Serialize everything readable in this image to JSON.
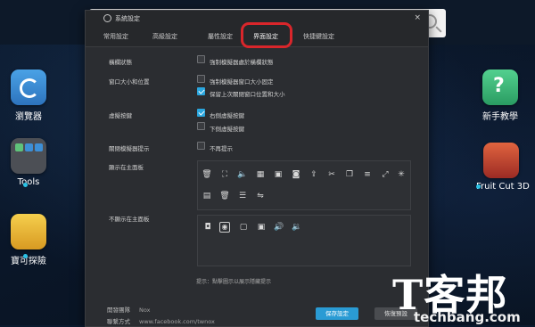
{
  "dialog": {
    "title": "系統設定",
    "close_glyph": "×",
    "tabs": [
      {
        "label": "常用設定"
      },
      {
        "label": "高級設定"
      },
      {
        "label": "屬性設定"
      },
      {
        "label": "界面設定",
        "active": true
      },
      {
        "label": "快捷鍵設定"
      }
    ],
    "highlight_color": "#d9262b"
  },
  "settings": {
    "sidebar_state": {
      "label": "橫欄狀態",
      "option": "強制模擬器處於橫欄狀態",
      "checked": false
    },
    "window_size": {
      "label": "窗口大小和位置",
      "options": [
        {
          "text": "強制模擬器窗口大小固定",
          "checked": false
        },
        {
          "text": "保留上次關閉窗口位置和大小",
          "checked": true
        }
      ]
    },
    "virtual_keys": {
      "label": "虛擬按鍵",
      "options": [
        {
          "text": "右側虛擬按鍵",
          "checked": true
        },
        {
          "text": "下側虛擬按鍵",
          "checked": false
        }
      ]
    },
    "close_prompt": {
      "label": "關閉模擬器提示",
      "option": "不再提示",
      "checked": false
    },
    "show_panel": {
      "label": "顯示在主面板",
      "row1": [
        {
          "icon": "trash-icon",
          "glyph": "🗑"
        },
        {
          "icon": "expand-icon",
          "glyph": "⛶"
        },
        {
          "icon": "volume-up-icon",
          "glyph": "🔈"
        },
        {
          "icon": "package-icon",
          "glyph": "▦"
        },
        {
          "icon": "screenshot-icon",
          "glyph": "▣"
        },
        {
          "icon": "camera-icon",
          "glyph": "◙"
        },
        {
          "icon": "share-icon",
          "glyph": "⇪"
        },
        {
          "icon": "scissors-icon",
          "glyph": "✂"
        },
        {
          "icon": "copy-icon",
          "glyph": "❐"
        },
        {
          "icon": "menu-icon",
          "glyph": "≡"
        },
        {
          "icon": "arrows-icon",
          "glyph": "⤢"
        },
        {
          "icon": "loading-icon",
          "glyph": "✳"
        }
      ],
      "row2": [
        {
          "icon": "stack-icon",
          "glyph": "▤"
        },
        {
          "icon": "delete-icon",
          "glyph": "🗑"
        },
        {
          "icon": "list-icon",
          "glyph": "☰"
        },
        {
          "icon": "sliders-icon",
          "glyph": "⇋"
        }
      ]
    },
    "hidden_panel": {
      "label": "不顯示在主面板",
      "items": [
        {
          "icon": "camera-icon",
          "glyph": "◘"
        },
        {
          "icon": "location-icon",
          "glyph": "◉",
          "selected": true
        },
        {
          "icon": "screen-record-icon",
          "glyph": "▢"
        },
        {
          "icon": "image-icon",
          "glyph": "▣"
        },
        {
          "icon": "volume-up-icon",
          "glyph": "🔊"
        },
        {
          "icon": "volume-down-icon",
          "glyph": "🔉"
        }
      ]
    },
    "hint": "提示：點擊圖示以展示隱藏提示"
  },
  "footer": {
    "developer_label": "開發團隊",
    "developer_value": "Nox",
    "contact_label": "聯繫方式",
    "contact_value": "www.facebook.com/twnox",
    "save_label": "保存設定",
    "reset_label": "恢復預設"
  },
  "desktop": {
    "left_apps": [
      {
        "label": "瀏覽器",
        "color": "#3a8fd8"
      },
      {
        "label": "Tools",
        "color": "#4c4f55"
      },
      {
        "label": "寶可探險",
        "color": "#e8b33a"
      }
    ],
    "right_apps": [
      {
        "label": "新手教學",
        "color": "#39b97a"
      },
      {
        "label": "Fruit Cut 3D",
        "color": "#c2473b"
      }
    ]
  },
  "watermark": {
    "big": "T客邦",
    "small": "techbang.com"
  }
}
